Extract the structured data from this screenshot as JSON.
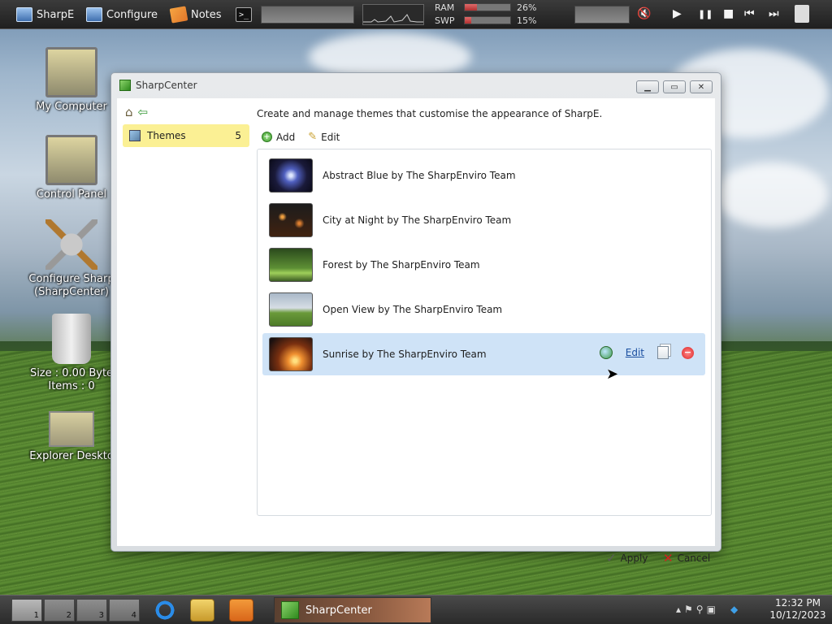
{
  "topbar": {
    "items": [
      {
        "label": "SharpE",
        "icon": "monitor-icon"
      },
      {
        "label": "Configure",
        "icon": "monitor-icon"
      },
      {
        "label": "Notes",
        "icon": "notes-icon"
      }
    ],
    "terminal_glyph": ">_",
    "ram_label": "RAM",
    "ram_value": "26%",
    "ram_fraction": 0.26,
    "swp_label": "SWP",
    "swp_value": "15%",
    "swp_fraction": 0.15,
    "media": {
      "play": "▶",
      "pause": "❚❚",
      "stop": "■",
      "prev": "⏮",
      "next": "⏭"
    }
  },
  "desktop": {
    "icons": [
      {
        "label": "My Computer",
        "icon": "computer-icon"
      },
      {
        "label": "Control Panel",
        "icon": "control-panel-icon"
      },
      {
        "label": "Configure Sharp (SharpCenter)",
        "icon": "tools-icon"
      },
      {
        "label": "Size : 0.00 Byte Items : 0",
        "icon": "recycle-bin-icon"
      },
      {
        "label": "Explorer Deskto",
        "icon": "folder-icon"
      }
    ]
  },
  "window": {
    "title": "SharpCenter",
    "description": "Create and manage themes that customise the appearance of SharpE.",
    "sidebar": {
      "item_label": "Themes",
      "item_count": "5"
    },
    "toolbar": {
      "add_label": "Add",
      "edit_label": "Edit"
    },
    "themes": [
      {
        "name": "Abstract Blue by The SharpEnviro Team"
      },
      {
        "name": "City at Night by The SharpEnviro Team"
      },
      {
        "name": "Forest by The SharpEnviro Team"
      },
      {
        "name": "Open View by The SharpEnviro Team"
      },
      {
        "name": "Sunrise by The SharpEnviro Team",
        "selected": true
      }
    ],
    "row_edit_link": "Edit",
    "apply_label": "Apply",
    "cancel_label": "Cancel"
  },
  "taskbar": {
    "workspaces": [
      "1",
      "2",
      "3",
      "4"
    ],
    "active_task": "SharpCenter",
    "clock_time": "12:32 PM",
    "clock_date": "10/12/2023"
  }
}
